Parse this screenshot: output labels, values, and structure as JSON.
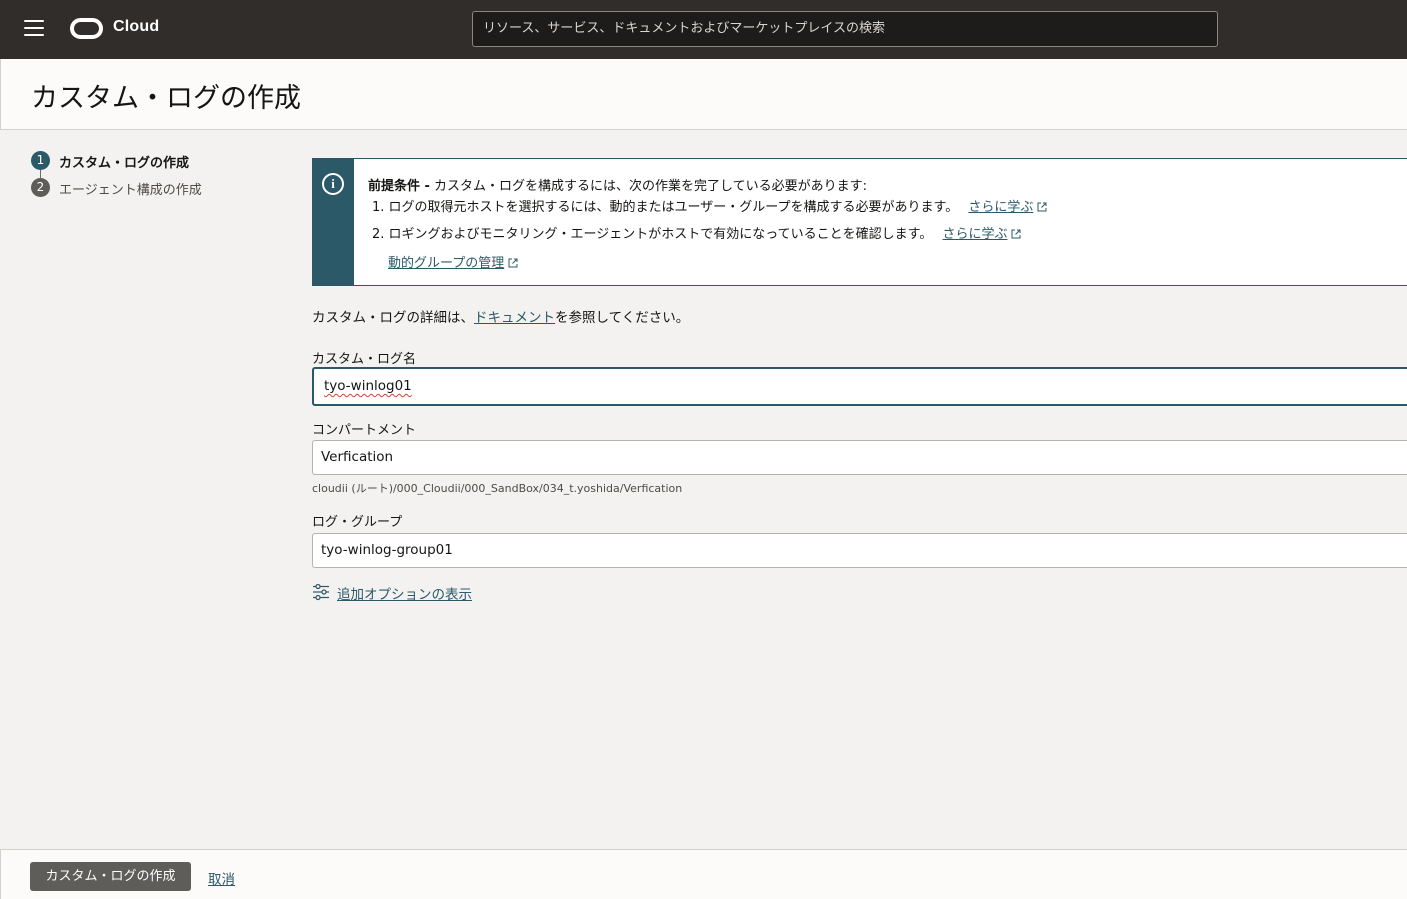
{
  "topbar": {
    "brand": "Cloud",
    "search_placeholder": "リソース、サービス、ドキュメントおよびマーケットプレイスの検索"
  },
  "page": {
    "title": "カスタム・ログの作成"
  },
  "steps": [
    {
      "num": "1",
      "label": "カスタム・ログの作成",
      "active": true
    },
    {
      "num": "2",
      "label": "エージェント構成の作成",
      "active": false
    }
  ],
  "notice": {
    "bold": "前提条件 -",
    "intro": " カスタム・ログを構成するには、次の作業を完了している必要があります:",
    "item1": "1. ログの取得元ホストを選択するには、動的またはユーザー・グループを構成する必要があります。",
    "item2": "2. ロギングおよびモニタリング・エージェントがホストで有効になっていることを確認します。",
    "learn_more": "さらに学ぶ",
    "manage_groups": "動的グループの管理"
  },
  "doc_line": {
    "before": "カスタム・ログの詳細は、",
    "link": "ドキュメント",
    "after": "を参照してください。"
  },
  "form": {
    "log_name_label": "カスタム・ログ名",
    "log_name_value": "tyo-winlog01",
    "compartment_label": "コンパートメント",
    "compartment_value": "Verfication",
    "compartment_path": "cloudii (ルート)/000_Cloudii/000_SandBox/034_t.yoshida/Verfication",
    "log_group_label": "ログ・グループ",
    "log_group_value": "tyo-winlog-group01",
    "more_options": "追加オプションの表示"
  },
  "footer": {
    "create_label": "カスタム・ログの作成",
    "cancel_label": "取消"
  },
  "colors": {
    "topbar": "#312d2a",
    "accent": "#2c5967",
    "primary_button": "#5f5d5a",
    "active_step": "#2c5967",
    "inactive_step": "#5f5d5a"
  }
}
